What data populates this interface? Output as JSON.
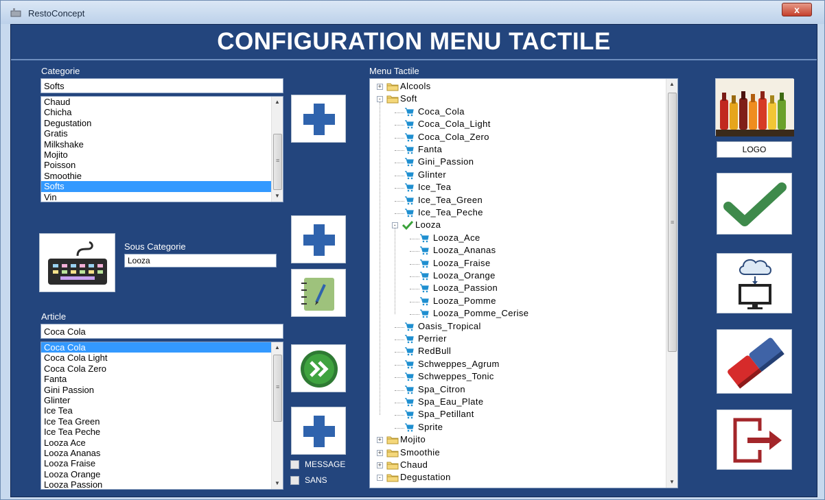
{
  "window": {
    "title": "RestoConcept",
    "close_label": "x"
  },
  "header": {
    "title": "CONFIGURATION MENU TACTILE"
  },
  "categorie": {
    "label": "Categorie",
    "value": "Softs",
    "items": [
      "Chaud",
      "Chicha",
      "Degustation",
      "Gratis",
      "Milkshake",
      "Mojito",
      "Poisson",
      "Smoothie",
      "Softs",
      "Vin"
    ],
    "selected": "Softs"
  },
  "sous_categorie": {
    "label": "Sous Categorie",
    "value": "Looza"
  },
  "article": {
    "label": "Article",
    "value": "Coca Cola",
    "items": [
      "Coca Cola",
      "Coca Cola Light",
      "Coca Cola Zero",
      "Fanta",
      "Gini Passion",
      "Glinter",
      "Ice Tea",
      "Ice Tea Green",
      "Ice Tea Peche",
      "Looza Ace",
      "Looza Ananas",
      "Looza Fraise",
      "Looza Orange",
      "Looza Passion"
    ],
    "selected": "Coca Cola"
  },
  "options": {
    "message_label": "MESSAGE",
    "sans_label": "SANS"
  },
  "menu_tactile": {
    "label": "Menu Tactile",
    "nodes": [
      {
        "text": "Alcools",
        "level": 0,
        "icon": "folder-icon",
        "expander": "+"
      },
      {
        "text": "Soft",
        "level": 0,
        "icon": "folder-icon",
        "expander": "-"
      },
      {
        "text": "Coca_Cola",
        "level": 1,
        "icon": "cart-icon"
      },
      {
        "text": "Coca_Cola_Light",
        "level": 1,
        "icon": "cart-icon"
      },
      {
        "text": "Coca_Cola_Zero",
        "level": 1,
        "icon": "cart-icon"
      },
      {
        "text": "Fanta",
        "level": 1,
        "icon": "cart-icon"
      },
      {
        "text": "Gini_Passion",
        "level": 1,
        "icon": "cart-icon"
      },
      {
        "text": "Glinter",
        "level": 1,
        "icon": "cart-icon"
      },
      {
        "text": "Ice_Tea",
        "level": 1,
        "icon": "cart-icon"
      },
      {
        "text": "Ice_Tea_Green",
        "level": 1,
        "icon": "cart-icon"
      },
      {
        "text": "Ice_Tea_Peche",
        "level": 1,
        "icon": "cart-icon"
      },
      {
        "text": "Looza",
        "level": 1,
        "icon": "checkmark-icon",
        "expander": "-"
      },
      {
        "text": "Looza_Ace",
        "level": 2,
        "icon": "cart-icon"
      },
      {
        "text": "Looza_Ananas",
        "level": 2,
        "icon": "cart-icon"
      },
      {
        "text": "Looza_Fraise",
        "level": 2,
        "icon": "cart-icon"
      },
      {
        "text": "Looza_Orange",
        "level": 2,
        "icon": "cart-icon"
      },
      {
        "text": "Looza_Passion",
        "level": 2,
        "icon": "cart-icon"
      },
      {
        "text": "Looza_Pomme",
        "level": 2,
        "icon": "cart-icon"
      },
      {
        "text": "Looza_Pomme_Cerise",
        "level": 2,
        "icon": "cart-icon"
      },
      {
        "text": "Oasis_Tropical",
        "level": 1,
        "icon": "cart-icon"
      },
      {
        "text": "Perrier",
        "level": 1,
        "icon": "cart-icon"
      },
      {
        "text": "RedBull",
        "level": 1,
        "icon": "cart-icon"
      },
      {
        "text": "Schweppes_Agrum",
        "level": 1,
        "icon": "cart-icon"
      },
      {
        "text": "Schweppes_Tonic",
        "level": 1,
        "icon": "cart-icon"
      },
      {
        "text": "Spa_Citron",
        "level": 1,
        "icon": "cart-icon"
      },
      {
        "text": "Spa_Eau_Plate",
        "level": 1,
        "icon": "cart-icon"
      },
      {
        "text": "Spa_Petillant",
        "level": 1,
        "icon": "cart-icon"
      },
      {
        "text": "Sprite",
        "level": 1,
        "icon": "cart-icon"
      },
      {
        "text": "Mojito",
        "level": 0,
        "icon": "folder-icon",
        "expander": "+"
      },
      {
        "text": "Smoothie",
        "level": 0,
        "icon": "folder-icon",
        "expander": "+"
      },
      {
        "text": "Chaud",
        "level": 0,
        "icon": "folder-icon",
        "expander": "+"
      },
      {
        "text": "Degustation",
        "level": 0,
        "icon": "folder-icon",
        "expander": "-"
      }
    ]
  },
  "right_panel": {
    "logo_label": "LOGO"
  },
  "colors": {
    "background": "#23457d",
    "selection": "#3399ff",
    "plus_blue": "#2f63ad",
    "validate_green": "#3e8a4b",
    "exit_red": "#a3262a"
  }
}
